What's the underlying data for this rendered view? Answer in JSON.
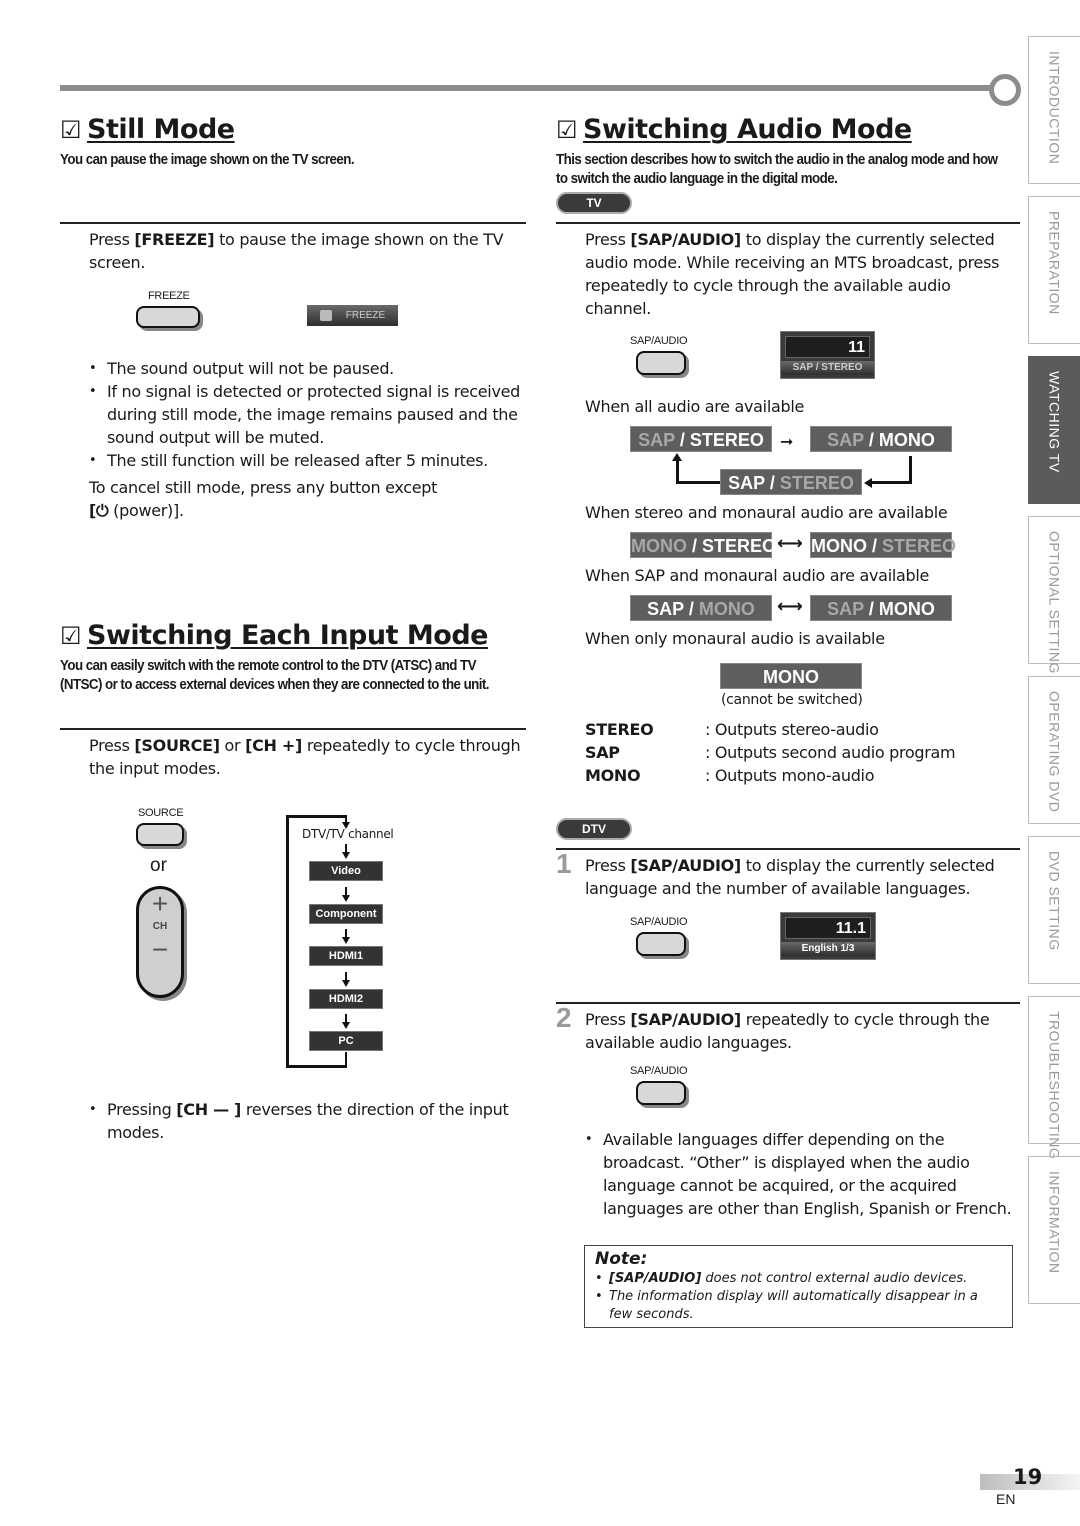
{
  "page": {
    "number": "19",
    "lang": "EN"
  },
  "side_tabs": [
    {
      "label": "INTRODUCTION",
      "active": false
    },
    {
      "label": "PREPARATION",
      "active": false
    },
    {
      "label": "WATCHING  TV",
      "active": true
    },
    {
      "label": "OPTIONAL  SETTING",
      "active": false
    },
    {
      "label": "OPERATING  DVD",
      "active": false
    },
    {
      "label": "DVD  SETTING",
      "active": false
    },
    {
      "label": "TROUBLESHOOTING",
      "active": false
    },
    {
      "label": "INFORMATION",
      "active": false
    }
  ],
  "still_mode": {
    "check": "☑",
    "title": "Still Mode",
    "subtitle": "You can pause the image shown on the TV screen.",
    "step_pre": "Press ",
    "step_key": "[FREEZE]",
    "step_post": " to pause the image shown on the TV screen.",
    "button_label": "FREEZE",
    "osd_label": "FREEZE",
    "bullets": [
      "The sound output will not be paused.",
      "If no signal is detected or protected signal is received during still mode, the image remains paused and the sound output will be muted.",
      "The still function will be released after 5 minutes."
    ],
    "cancel_text": "To cancel still mode, press any button except",
    "cancel_key_open": "[",
    "cancel_key_icon": "⏻",
    "cancel_key_rest": " (power)]."
  },
  "input_mode": {
    "check": "☑",
    "title": "Switching Each Input Mode",
    "subtitle_1": "You can easily switch with the remote control to the DTV (ATSC) and TV",
    "subtitle_2": "(NTSC) or to access external devices when they are connected to the unit.",
    "step_pre": "Press ",
    "step_key1": "[SOURCE]",
    "step_mid": " or ",
    "step_key2": "[CH +]",
    "step_post": " repeatedly to cycle through the input modes.",
    "source_label": "SOURCE",
    "or_label": "or",
    "ch_plus": "+",
    "ch_label": "CH",
    "ch_minus": "−",
    "flow_first": "DTV/TV channel",
    "flow": [
      "Video",
      "Component",
      "HDMI1",
      "HDMI2",
      "PC"
    ],
    "bullet_pre": "Pressing ",
    "bullet_key": "[CH — ]",
    "bullet_post": " reverses the direction of the input modes."
  },
  "audio_mode": {
    "check": "☑",
    "title": "Switching Audio Mode",
    "subtitle_1": "This section describes how to switch the audio in the analog mode and how",
    "subtitle_2": "to switch the audio language in the digital mode.",
    "tv_chip": "TV",
    "step_pre": "Press ",
    "step_key": "[SAP/AUDIO]",
    "step_post": " to display the currently selected audio mode. While receiving an MTS broadcast, press repeatedly to cycle through the available audio channel.",
    "button_label": "SAP/AUDIO",
    "osd_channel": "11",
    "osd_mode": "SAP / STEREO",
    "case_all": "When all audio are available",
    "case_stereo_mono": "When stereo and monaural audio are available",
    "case_sap_mono": "When SAP and monaural audio are available",
    "case_mono_only": "When only monaural audio is available",
    "cannot_switch": "(cannot be switched)",
    "sap": "SAP",
    "mono": "MONO",
    "stereo": "STEREO",
    "slash": " / ",
    "legend": [
      {
        "term": "STEREO",
        "desc": ": Outputs stereo-audio"
      },
      {
        "term": "SAP",
        "desc": ": Outputs second audio program"
      },
      {
        "term": "MONO",
        "desc": ": Outputs mono-audio"
      }
    ],
    "dtv_chip": "DTV",
    "step1_num": "1",
    "step1_pre": "Press ",
    "step1_key": "[SAP/AUDIO]",
    "step1_post": " to display the currently selected language and the number of available languages.",
    "osd_dtv_channel": "11.1",
    "osd_language": "English 1/3",
    "step2_num": "2",
    "step2_pre": "Press ",
    "step2_key": "[SAP/AUDIO]",
    "step2_post": " repeatedly to cycle through the available audio languages.",
    "bullet": "Available languages differ depending on the broadcast. “Other” is displayed when the audio language cannot be acquired, or the acquired languages are other than English, Spanish or French.",
    "note_title": "Note:",
    "note_items": [
      {
        "key": "[SAP/AUDIO]",
        "text": " does not control external audio devices."
      },
      {
        "key": "",
        "text": "The information display will automatically disappear in a few seconds."
      }
    ]
  }
}
